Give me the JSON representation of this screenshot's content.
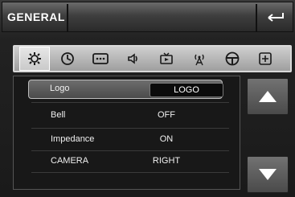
{
  "header": {
    "title": "GENERAL",
    "back_icon": "return-arrow-icon"
  },
  "tabs": [
    {
      "name": "settings-gear-icon",
      "active": true
    },
    {
      "name": "clock-icon",
      "active": false
    },
    {
      "name": "more-dots-icon",
      "active": false
    },
    {
      "name": "speaker-icon",
      "active": false
    },
    {
      "name": "tv-icon",
      "active": false
    },
    {
      "name": "antenna-icon",
      "active": false
    },
    {
      "name": "steering-wheel-icon",
      "active": false
    },
    {
      "name": "plus-box-icon",
      "active": false
    }
  ],
  "list": {
    "rows": [
      {
        "label": "Logo",
        "value": "LOGO"
      },
      {
        "label": "Bell",
        "value": "OFF"
      },
      {
        "label": "Impedance",
        "value": "ON"
      },
      {
        "label": "CAMERA",
        "value": "RIGHT"
      }
    ]
  },
  "scroll": {
    "up_icon": "arrow-up-icon",
    "down_icon": "arrow-down-icon"
  },
  "colors": {
    "background": "#1b1b1b",
    "tabbar": "#b0b0b0",
    "selected_row": "#5a5a5a",
    "text": "#f2f2f2"
  }
}
